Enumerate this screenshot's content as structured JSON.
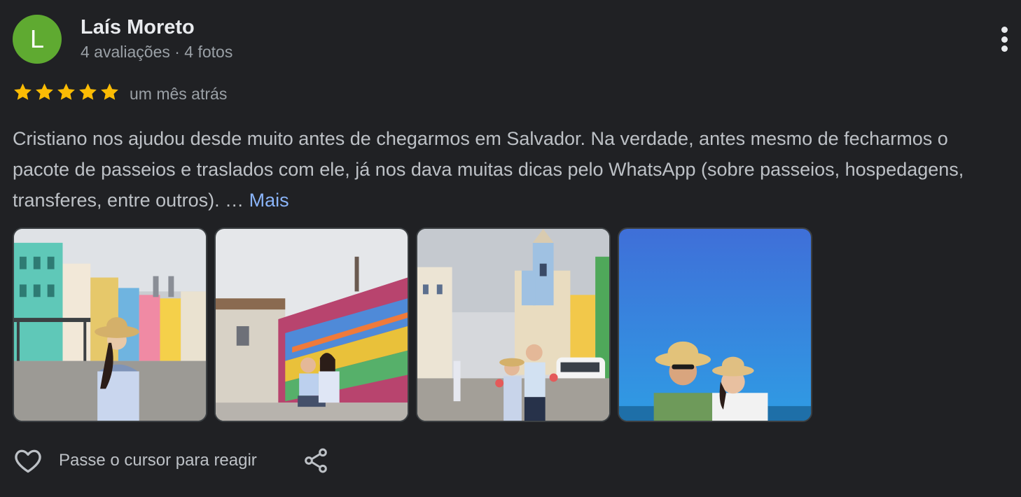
{
  "reviewer": {
    "avatar_letter": "L",
    "name": "Laís Moreto",
    "meta": "4 avaliações · 4 fotos"
  },
  "review": {
    "rating": 5,
    "date": "um mês atrás",
    "text": "Cristiano nos ajudou desde muito antes de chegarmos em Salvador. Na verdade, antes mesmo de fecharmos o pacote de passeios e traslados com ele, já nos dava muitas dicas pelo WhatsApp (sobre passeios, hospedagens, transferes, entre outros). …",
    "more_label": "Mais"
  },
  "photos": [
    {
      "name": "photo-pelourinho-woman-hat"
    },
    {
      "name": "photo-ribbon-wall-couple"
    },
    {
      "name": "photo-church-square-couple"
    },
    {
      "name": "photo-beach-couple-hats"
    }
  ],
  "actions": {
    "react_label": "Passe o cursor para reagir"
  },
  "colors": {
    "background": "#202124",
    "avatar": "#5faa31",
    "star": "#fbbc04",
    "link": "#8ab4f8"
  },
  "icons": [
    "more-vert-icon",
    "star-icon",
    "heart-outline-icon",
    "share-icon"
  ]
}
